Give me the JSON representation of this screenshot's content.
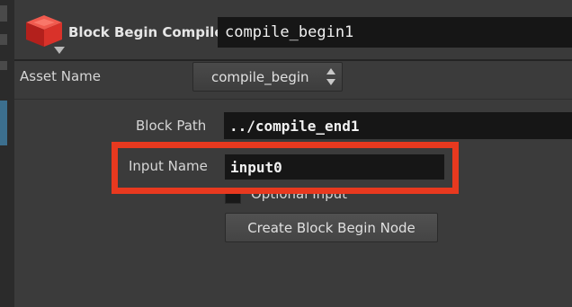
{
  "header": {
    "op_label": "Block Begin Compile",
    "node_name": "compile_begin1",
    "node_icon": "red-compile-block-icon"
  },
  "asset": {
    "label": "Asset Name",
    "value": "compile_begin"
  },
  "params": {
    "block_path_label": "Block Path",
    "block_path_value": "../compile_end1",
    "input_name_label": "Input Name",
    "input_name_value": "input0",
    "optional_input_label": "Optional Input",
    "create_button_label": "Create Block Begin Node"
  },
  "colors": {
    "highlight": "#e8391f",
    "icon_red": "#d9322a",
    "background": "#3b3b3b",
    "field": "#161616"
  }
}
